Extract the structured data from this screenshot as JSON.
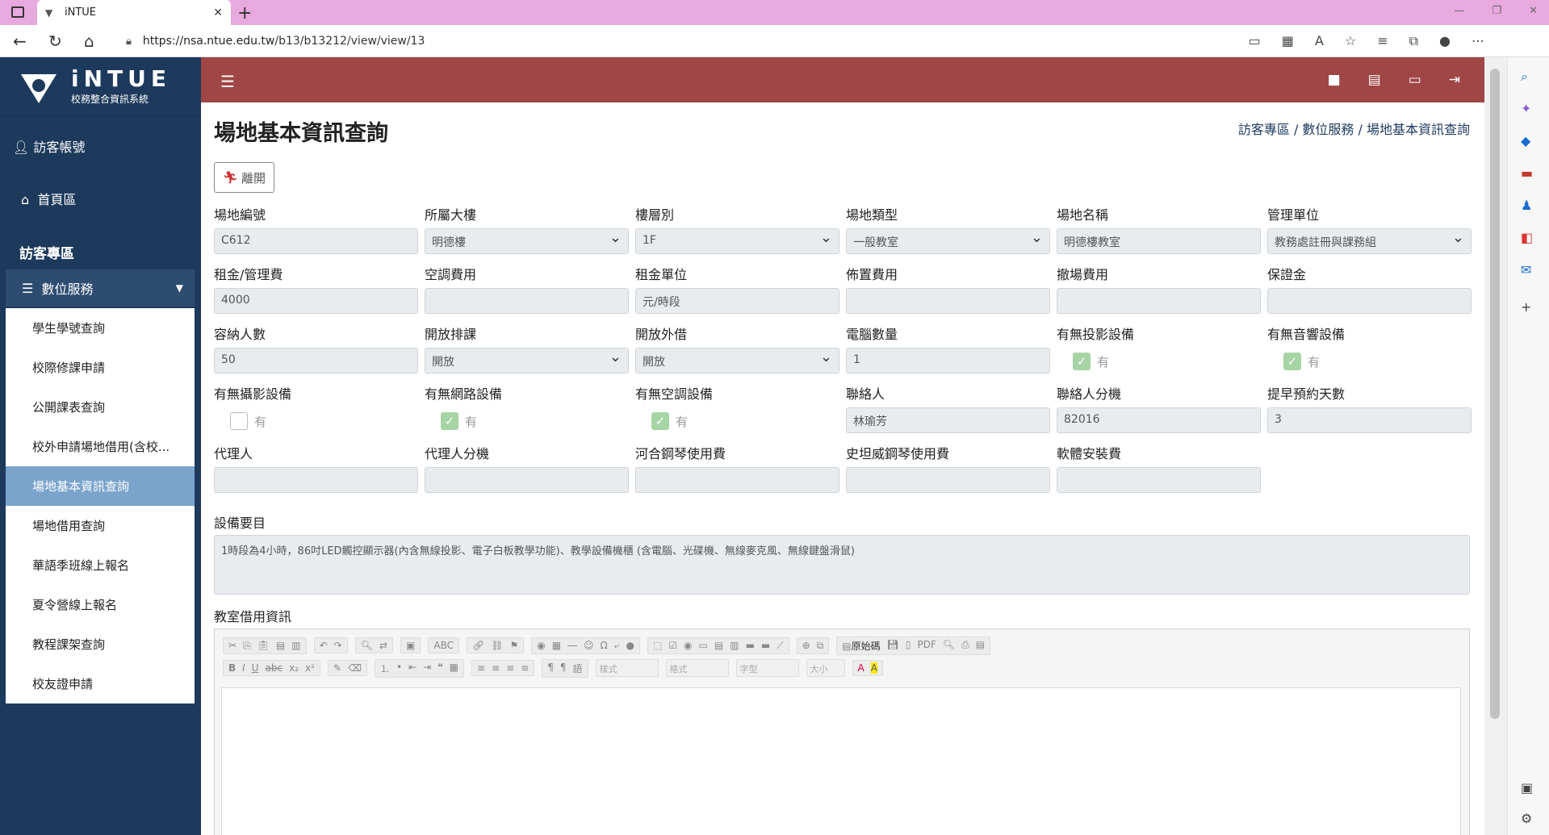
{
  "browser": {
    "tab_title": "iNTUE",
    "url_host": "https://nsa.ntue.edu.tw",
    "url_path": "/b13/b13212/view/view/13"
  },
  "sidebar": {
    "logo_title": "iNTUE",
    "logo_sub": "校務整合資訊系統",
    "user": "訪客帳號",
    "home": "首頁區",
    "section": "訪客專區",
    "group": "數位服務",
    "items": [
      {
        "label": "學生學號查詢"
      },
      {
        "label": "校際修課申請"
      },
      {
        "label": "公開課表查詢"
      },
      {
        "label": "校外申請場地借用(含校..."
      },
      {
        "label": "場地基本資訊查詢"
      },
      {
        "label": "場地借用查詢"
      },
      {
        "label": "華語季班線上報名"
      },
      {
        "label": "夏令營線上報名"
      },
      {
        "label": "教程課架查詢"
      },
      {
        "label": "校友證申請"
      }
    ]
  },
  "page": {
    "title": "場地基本資訊查詢",
    "breadcrumb": "訪客專區 / 數位服務 / 場地基本資訊查詢",
    "leave_label": "離開"
  },
  "form": {
    "row1": [
      {
        "label": "場地編號",
        "value": "C612",
        "type": "text"
      },
      {
        "label": "所屬大樓",
        "value": "明德樓",
        "type": "select"
      },
      {
        "label": "樓層別",
        "value": "1F",
        "type": "select"
      },
      {
        "label": "場地類型",
        "value": "一般教室",
        "type": "select"
      },
      {
        "label": "場地名稱",
        "value": "明德樓教室",
        "type": "text"
      },
      {
        "label": "管理單位",
        "value": "教務處註冊與課務組",
        "type": "select"
      }
    ],
    "row2": [
      {
        "label": "租金/管理費",
        "value": "4000",
        "type": "text"
      },
      {
        "label": "空調費用",
        "value": "",
        "type": "text"
      },
      {
        "label": "租金單位",
        "value": "元/時段",
        "type": "text"
      },
      {
        "label": "佈置費用",
        "value": "",
        "type": "text"
      },
      {
        "label": "撤場費用",
        "value": "",
        "type": "text"
      },
      {
        "label": "保證金",
        "value": "",
        "type": "text"
      }
    ],
    "row3": [
      {
        "label": "容納人數",
        "value": "50",
        "type": "text"
      },
      {
        "label": "開放排課",
        "value": "開放",
        "type": "select"
      },
      {
        "label": "開放外借",
        "value": "開放",
        "type": "select"
      },
      {
        "label": "電腦數量",
        "value": "1",
        "type": "text"
      },
      {
        "label": "有無投影設備",
        "value": "有",
        "type": "checkbox",
        "checked": true
      },
      {
        "label": "有無音響設備",
        "value": "有",
        "type": "checkbox",
        "checked": true
      }
    ],
    "row4": [
      {
        "label": "有無攝影設備",
        "value": "有",
        "type": "checkbox",
        "checked": false
      },
      {
        "label": "有無網路設備",
        "value": "有",
        "type": "checkbox",
        "checked": true
      },
      {
        "label": "有無空調設備",
        "value": "有",
        "type": "checkbox",
        "checked": true
      },
      {
        "label": "聯絡人",
        "value": "林瑜芳",
        "type": "text"
      },
      {
        "label": "聯絡人分機",
        "value": "82016",
        "type": "text"
      },
      {
        "label": "提早預約天數",
        "value": "3",
        "type": "text"
      }
    ],
    "row5": [
      {
        "label": "代理人",
        "value": "",
        "type": "text"
      },
      {
        "label": "代理人分機",
        "value": "",
        "type": "text"
      },
      {
        "label": "河合鋼琴使用費",
        "value": "",
        "type": "text"
      },
      {
        "label": "史坦威鋼琴使用費",
        "value": "",
        "type": "text"
      },
      {
        "label": "軟體安裝費",
        "value": "",
        "type": "text"
      }
    ],
    "equip_label": "設備要目",
    "equip_value": "1時段為4小時，86吋LED觸控顯示器(內含無線投影、電子白板教學功能)、教學設備機櫃 (含電腦、光碟機、無線麥克風、無線鍵盤滑鼠)",
    "borrow_label": "教室借用資訊"
  },
  "editor": {
    "source_label": "原始碼",
    "style_combo": "樣式",
    "format_combo": "格式",
    "font_combo": "字型",
    "size_combo": "大小"
  }
}
